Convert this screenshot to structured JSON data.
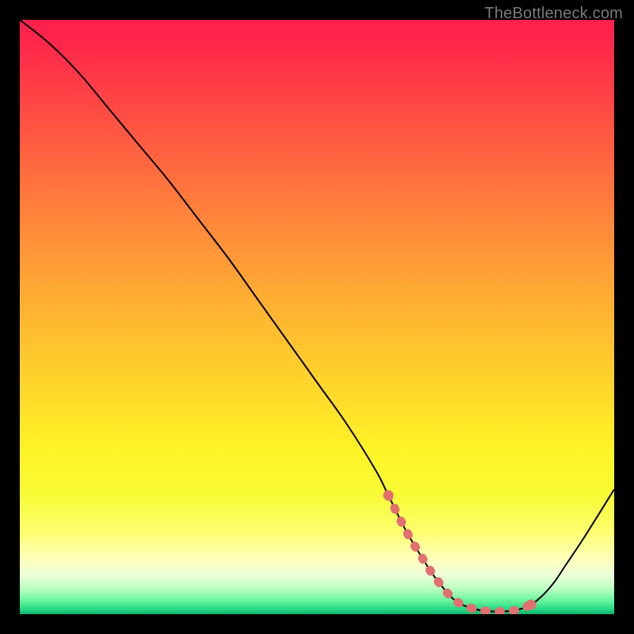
{
  "attribution": "TheBottleneck.com",
  "chart_data": {
    "type": "line",
    "title": "",
    "xlabel": "",
    "ylabel": "",
    "xlim": [
      0,
      100
    ],
    "ylim": [
      0,
      100
    ],
    "grid": false,
    "legend": false,
    "series": [
      {
        "name": "bottleneck-curve",
        "x": [
          0,
          5,
          10,
          15,
          20,
          25,
          30,
          35,
          40,
          45,
          50,
          55,
          60,
          62,
          65,
          68,
          70,
          73,
          76,
          79,
          82,
          84,
          86,
          88,
          90,
          92,
          95,
          100
        ],
        "y": [
          100,
          96,
          91,
          85,
          79,
          73,
          66.5,
          60,
          53,
          46,
          39,
          32,
          24,
          20,
          14,
          9,
          6,
          2.5,
          1.0,
          0.5,
          0.5,
          0.8,
          1.6,
          3.2,
          5.5,
          8.5,
          13,
          21
        ]
      },
      {
        "name": "highlight-band",
        "x": [
          62,
          65,
          68,
          70,
          73,
          76,
          79,
          82,
          84,
          86
        ],
        "y": [
          20,
          14,
          9,
          6,
          2.5,
          1.0,
          0.5,
          0.5,
          0.8,
          1.6
        ]
      }
    ],
    "background_gradient": {
      "stops": [
        {
          "offset": 0.0,
          "color": "#ff1f4e"
        },
        {
          "offset": 0.05,
          "color": "#ff2a4a"
        },
        {
          "offset": 0.15,
          "color": "#ff4a44"
        },
        {
          "offset": 0.25,
          "color": "#ff6a3f"
        },
        {
          "offset": 0.35,
          "color": "#ff8a3a"
        },
        {
          "offset": 0.45,
          "color": "#ffa834"
        },
        {
          "offset": 0.55,
          "color": "#ffc42e"
        },
        {
          "offset": 0.65,
          "color": "#ffdf29"
        },
        {
          "offset": 0.72,
          "color": "#fff326"
        },
        {
          "offset": 0.8,
          "color": "#f7fb35"
        },
        {
          "offset": 0.86,
          "color": "#fdff6e"
        },
        {
          "offset": 0.905,
          "color": "#ffffb8"
        },
        {
          "offset": 0.935,
          "color": "#ecffd8"
        },
        {
          "offset": 0.958,
          "color": "#b8ffbf"
        },
        {
          "offset": 0.978,
          "color": "#63f39a"
        },
        {
          "offset": 0.992,
          "color": "#23d884"
        },
        {
          "offset": 1.0,
          "color": "#0fb26b"
        }
      ]
    },
    "colors": {
      "curve": "#000000",
      "highlight": "#e17070"
    }
  }
}
